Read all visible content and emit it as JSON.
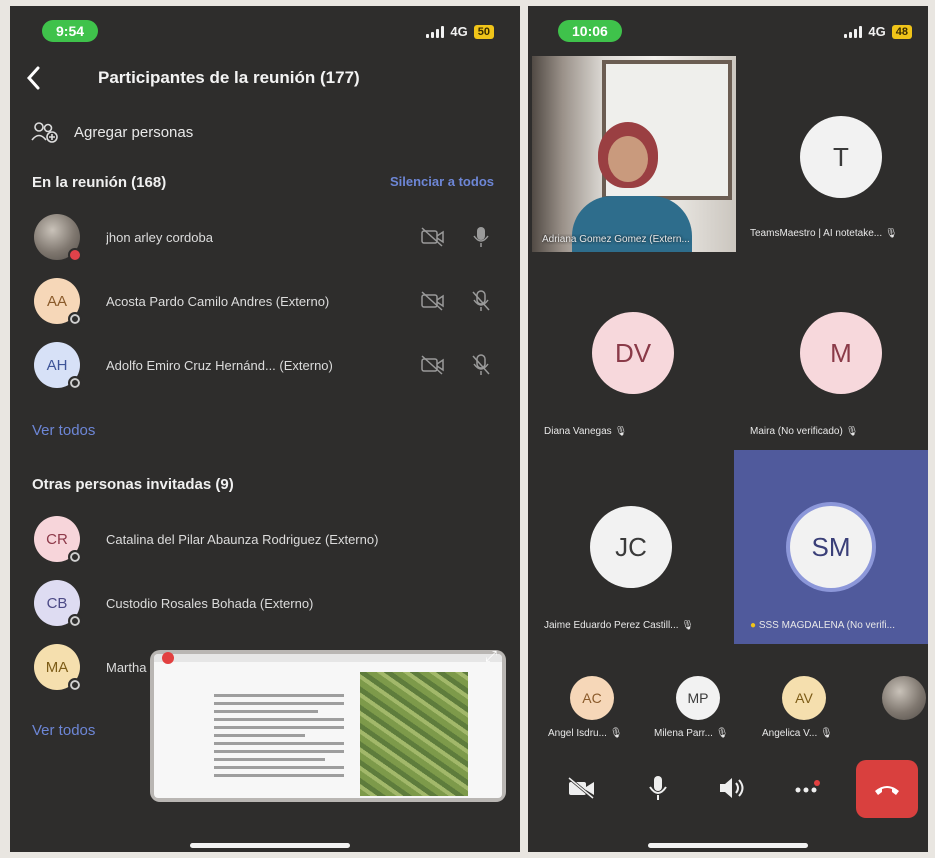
{
  "left": {
    "status": {
      "time": "9:54",
      "network": "4G",
      "battery": "50"
    },
    "header": {
      "back_icon": "chevron-left-icon",
      "title": "Participantes de la reunión (177)"
    },
    "add_people": {
      "icon": "add-people-icon",
      "label": "Agregar personas"
    },
    "in_meeting": {
      "title": "En la reunión (168)",
      "mute_all": "Silenciar a todos",
      "participants": [
        {
          "initials": "",
          "name": "jhon arley cordoba",
          "avatar_type": "photo",
          "camera": "camera-off-icon",
          "mic": "mic-on-icon"
        },
        {
          "initials": "AA",
          "name": "Acosta Pardo Camilo Andres (Externo)",
          "avatar_type": "peach",
          "camera": "camera-off-icon",
          "mic": "mic-off-icon"
        },
        {
          "initials": "AH",
          "name": "Adolfo Emiro Cruz Hernánd...  (Externo)",
          "avatar_type": "blue",
          "camera": "camera-off-icon",
          "mic": "mic-off-icon"
        }
      ],
      "see_all": "Ver todos"
    },
    "invited": {
      "title": "Otras personas invitadas (9)",
      "people": [
        {
          "initials": "CR",
          "name": "Catalina del Pilar Abaunza Rodriguez (Externo)",
          "avatar_type": "pink"
        },
        {
          "initials": "CB",
          "name": "Custodio Rosales Bohada (Externo)",
          "avatar_type": "lav"
        },
        {
          "initials": "MA",
          "name": "Martha",
          "avatar_type": "yellow"
        }
      ],
      "see_all": "Ver todos"
    },
    "share_preview": {
      "expand_icon": "expand-icon"
    }
  },
  "right": {
    "status": {
      "time": "10:06",
      "network": "4G",
      "battery": "48"
    },
    "tiles": [
      {
        "type": "video",
        "label": "Adriana Gomez Gomez (Extern..."
      },
      {
        "type": "avatar",
        "initials": "T",
        "label": "TeamsMaestro | AI notetake...",
        "muted": true
      },
      {
        "type": "avatar",
        "initials": "DV",
        "label": "Diana Vanegas",
        "muted": true
      },
      {
        "type": "avatar",
        "initials": "M",
        "label": "Maira (No verificado)",
        "muted": true
      },
      {
        "type": "avatar",
        "initials": "JC",
        "label": "Jaime Eduardo Perez Castill...",
        "muted": true
      },
      {
        "type": "avatar",
        "initials": "SM",
        "label": "SSS MAGDALENA (No verifi...",
        "muted": false,
        "active": true
      }
    ],
    "strip": [
      {
        "initials": "AC",
        "label": "Angel Isdru...",
        "muted": true
      },
      {
        "initials": "MP",
        "label": "Milena Parr...",
        "muted": true
      },
      {
        "initials": "AV",
        "label": "Angelica V...",
        "muted": true
      },
      {
        "initials": "",
        "label": "",
        "avatar_type": "photo"
      }
    ],
    "controls": [
      "camera-off-icon",
      "mic-icon",
      "speaker-icon",
      "more-icon",
      "leave-call-icon"
    ]
  },
  "colors": {
    "background": "#2e2d2c",
    "link": "#6d86d6",
    "time_pill": "#3fc24b",
    "active_tile": "#505a9c",
    "leave": "#d9403e"
  }
}
